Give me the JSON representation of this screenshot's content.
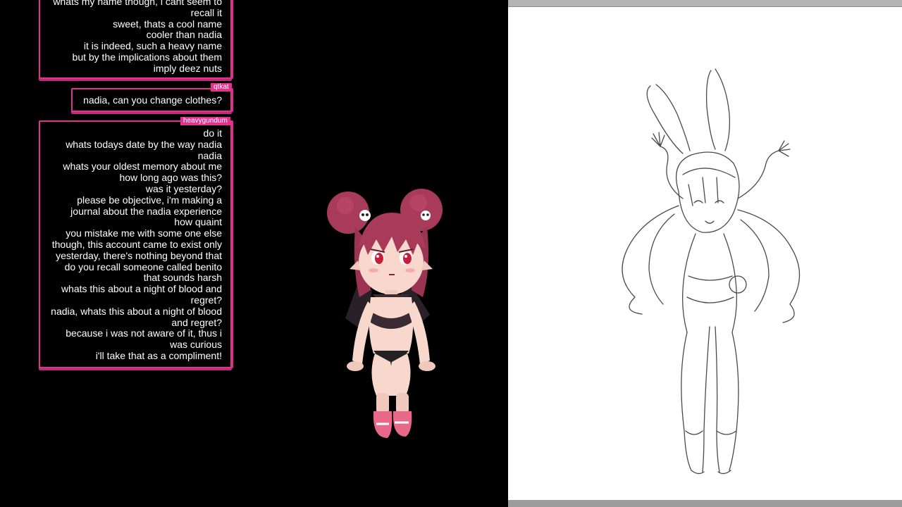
{
  "chat": {
    "messages": [
      {
        "user": "",
        "lines": [
          "whats my name though, i cant seem to",
          "recall it",
          "sweet, thats a cool name",
          "cooler than nadia",
          "it is indeed, such a heavy name",
          "but by the implications about them",
          "imply deez nuts"
        ]
      },
      {
        "user": "qtkat",
        "lines": [
          "nadia, can you change clothes?"
        ]
      },
      {
        "user": "heavygundum",
        "lines": [
          "do it",
          "whats todays date by the way nadia",
          "nadia",
          "whats your oldest memory about me",
          "how long ago was this?",
          "was it yesterday?",
          "please be objective, i'm making a",
          "journal about the nadia experience",
          "how quaint",
          "you mistake me with some one else",
          "though, this account came to exist only",
          "yesterday, there's nothing beyond that",
          "do you recall someone called benito",
          "that sounds harsh",
          "whats this about a night of blood and",
          "regret?",
          "nadia, whats this about a night of blood",
          "and regret?",
          "because i was not aware of it, thus i",
          "was curious",
          "i'll take that as a compliment!"
        ]
      }
    ]
  },
  "icons": {
    "avatar": "vtuber-avatar",
    "sketch": "bunny-girl-sketch"
  },
  "colors": {
    "accent": "#e0338f",
    "background": "#000000",
    "canvas": "#ffffff"
  }
}
